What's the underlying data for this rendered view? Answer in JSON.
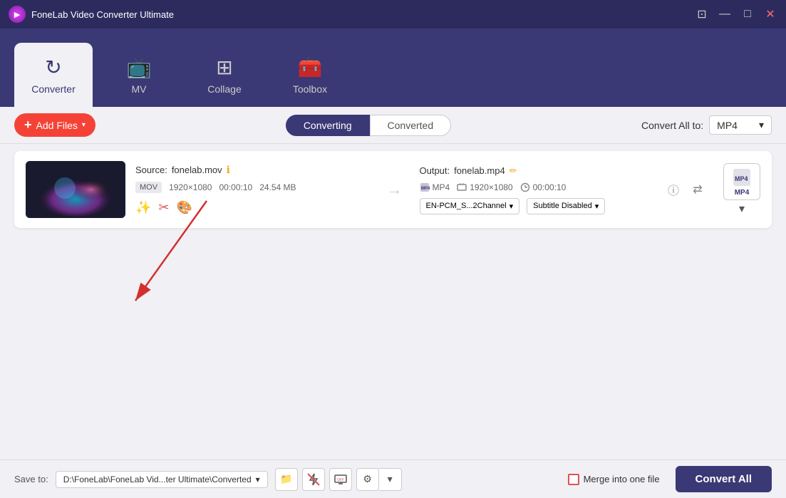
{
  "app": {
    "title": "FoneLab Video Converter Ultimate",
    "logo": "▶"
  },
  "titlebar": {
    "controls": {
      "chat": "⊡",
      "minimize": "—",
      "maximize": "□",
      "close": "✕"
    }
  },
  "tabs": [
    {
      "id": "converter",
      "label": "Converter",
      "icon": "↻",
      "active": true
    },
    {
      "id": "mv",
      "label": "MV",
      "icon": "📺"
    },
    {
      "id": "collage",
      "label": "Collage",
      "icon": "⊞"
    },
    {
      "id": "toolbox",
      "label": "Toolbox",
      "icon": "🧰"
    }
  ],
  "toolbar": {
    "add_files_label": "Add Files",
    "converting_label": "Converting",
    "converted_label": "Converted",
    "convert_all_to_label": "Convert All to:",
    "format": "MP4"
  },
  "file": {
    "source_label": "Source:",
    "source_filename": "fonelab.mov",
    "codec": "MOV",
    "resolution": "1920×1080",
    "duration": "00:00:10",
    "filesize": "24.54 MB",
    "output_label": "Output:",
    "output_filename": "fonelab.mp4",
    "output_codec": "MP4",
    "output_resolution": "1920×1080",
    "output_duration": "00:00:10",
    "audio_track": "EN-PCM_S...2Channel",
    "subtitle": "Subtitle Disabled",
    "format_badge": "MP4"
  },
  "bottom": {
    "save_to_label": "Save to:",
    "save_path": "D:\\FoneLab\\FoneLab Vid...ter Ultimate\\Converted",
    "merge_label": "Merge into one file",
    "convert_all_label": "Convert All"
  },
  "icons": {
    "info": "ℹ",
    "edit": "✏",
    "details": "ⓘ",
    "swap": "⇄",
    "effects": "✨",
    "cut": "✂",
    "palette": "🎨",
    "arrow_right": "→",
    "chevron_down": "▾",
    "folder": "📁",
    "flash_off": "⚡",
    "screen": "⊡",
    "gear": "⚙"
  }
}
